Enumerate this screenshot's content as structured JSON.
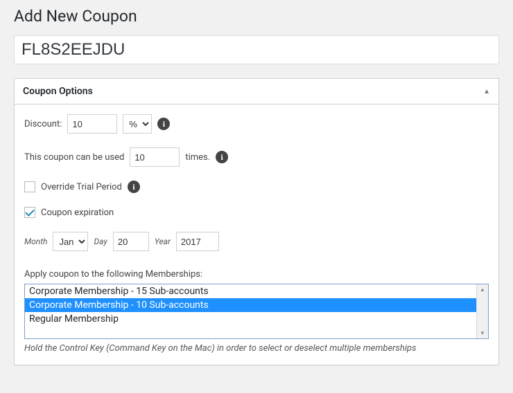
{
  "page": {
    "title": "Add New Coupon",
    "coupon_code": "FL8S2EEJDU"
  },
  "panel": {
    "title": "Coupon Options"
  },
  "discount": {
    "label": "Discount:",
    "value": "10",
    "unit_selected": "%"
  },
  "uses": {
    "label_before": "This coupon can be used",
    "value": "10",
    "label_after": "times."
  },
  "override_trial": {
    "label": "Override Trial Period",
    "checked": false
  },
  "expiration": {
    "label": "Coupon expiration",
    "checked": true
  },
  "date": {
    "month_label": "Month",
    "month_value": "Jan",
    "day_label": "Day",
    "day_value": "20",
    "year_label": "Year",
    "year_value": "2017"
  },
  "memberships": {
    "label": "Apply coupon to the following Memberships:",
    "options": [
      {
        "label": "Corporate Membership - 15 Sub-accounts",
        "selected": false
      },
      {
        "label": "Corporate Membership - 10 Sub-accounts",
        "selected": true
      },
      {
        "label": "Regular Membership",
        "selected": false
      }
    ],
    "hint": "Hold the Control Key (Command Key on the Mac) in order to select or deselect multiple memberships"
  }
}
